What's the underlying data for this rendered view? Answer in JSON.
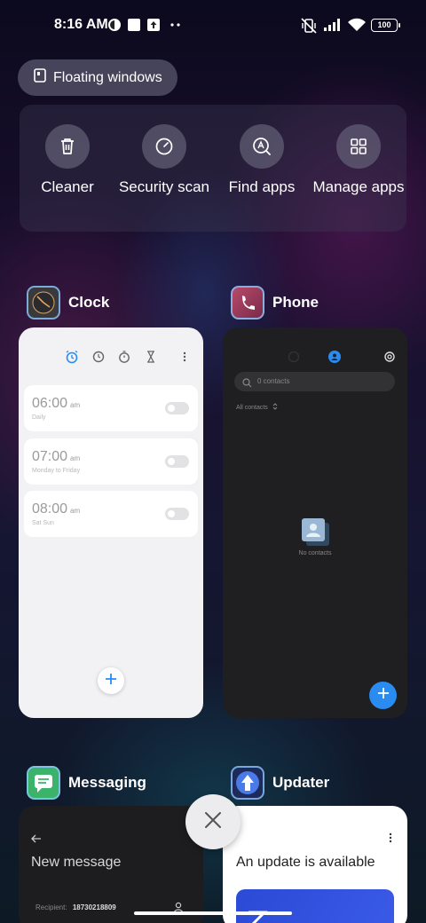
{
  "status_bar": {
    "time": "8:16 AM",
    "battery": "100",
    "icons": [
      "app-notification-icon",
      "square-notification-icon",
      "upload-icon",
      "more-dots-icon",
      "mute-vibrate-icon",
      "signal-icon",
      "wifi-icon",
      "battery-icon"
    ]
  },
  "floating_windows": {
    "label": "Floating windows",
    "icon": "floating-window-icon"
  },
  "quick_actions": [
    {
      "label": "Cleaner",
      "icon": "trash-icon"
    },
    {
      "label": "Security scan",
      "icon": "security-scan-icon"
    },
    {
      "label": "Find apps",
      "icon": "find-apps-icon"
    },
    {
      "label": "Manage apps",
      "icon": "grid-icon"
    }
  ],
  "apps": {
    "clock": {
      "name": "Clock",
      "alarms": [
        {
          "time": "06:00",
          "ampm": "am",
          "repeat": "Daily"
        },
        {
          "time": "07:00",
          "ampm": "am",
          "repeat": "Monday to Friday"
        },
        {
          "time": "08:00",
          "ampm": "am",
          "repeat": "Sat Sun"
        }
      ]
    },
    "phone": {
      "name": "Phone",
      "search_placeholder": "0 contacts",
      "filter": "All contacts",
      "empty_text": "No contacts"
    },
    "messaging": {
      "name": "Messaging",
      "title": "New message",
      "recipient_label": "Recipient:",
      "recipient_value": "18730218809"
    },
    "updater": {
      "name": "Updater",
      "title": "An update is available"
    }
  },
  "colors": {
    "accent_blue": "#2a8cf0",
    "card_light": "#f2f2f4",
    "card_dark": "#1f1f21"
  }
}
